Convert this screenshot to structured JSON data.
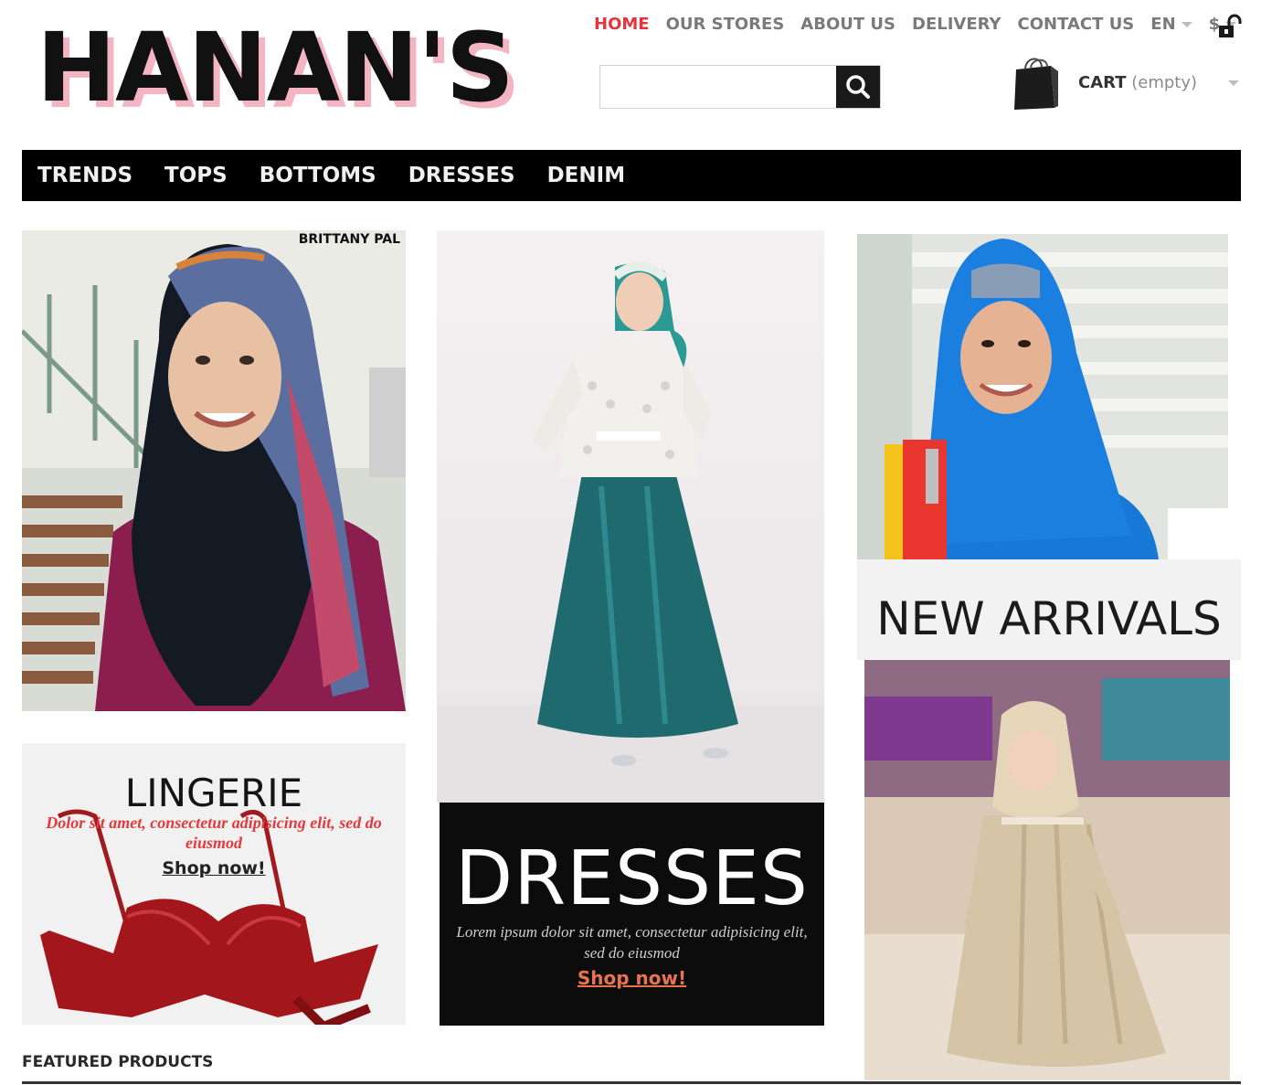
{
  "brand": {
    "logo_text": "HANAN'S",
    "accent_color": "#e8323c",
    "logo_shadow_color": "#f4b5c3"
  },
  "topnav": {
    "items": [
      {
        "label": "HOME",
        "active": true
      },
      {
        "label": "OUR STORES"
      },
      {
        "label": "ABOUT US"
      },
      {
        "label": "DELIVERY"
      },
      {
        "label": "CONTACT US"
      }
    ],
    "language": "EN",
    "currency": "$",
    "lock_icon": "unlock-icon"
  },
  "search": {
    "value": "",
    "placeholder": "",
    "icon": "search-icon"
  },
  "cart": {
    "label": "CART",
    "status": "(empty)",
    "icon": "shopping-bag-icon"
  },
  "mainnav": {
    "items": [
      "TRENDS",
      "TOPS",
      "BOTTOMS",
      "DRESSES",
      "DENIM"
    ]
  },
  "tiles": {
    "portrait_1": {
      "caption": "BRITTANY PAL"
    },
    "lingerie": {
      "title": "LINGERIE",
      "desc": "Dolor sit amet, consectetur adipisicing elit, sed do eiusmod",
      "shop": "Shop now!"
    },
    "dresses": {
      "title": "DRESSES",
      "desc": "Lorem ipsum dolor sit amet, consectetur adipisicing elit, sed do eiusmod",
      "shop": "Shop now!"
    },
    "new_arrivals": {
      "title": "NEW ARRIVALS"
    }
  },
  "featured": {
    "label": "FEATURED PRODUCTS"
  }
}
